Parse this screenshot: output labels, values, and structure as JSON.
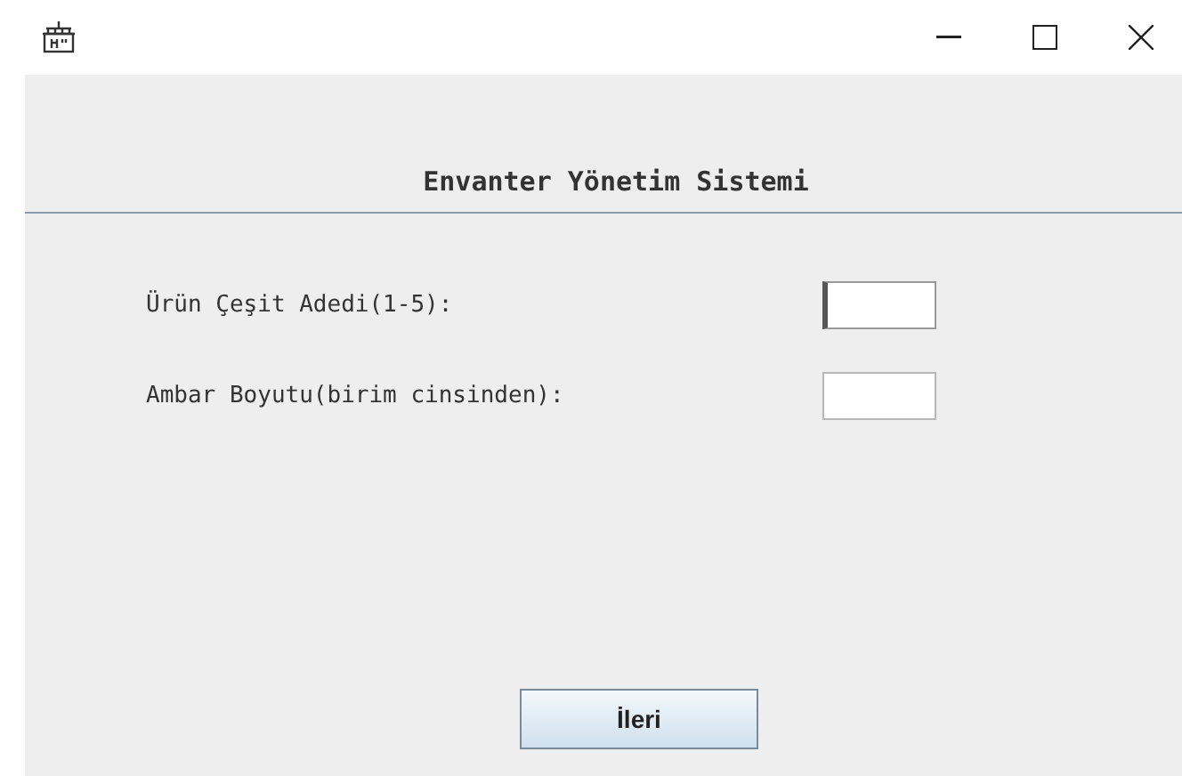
{
  "heading": "Envanter Yönetim Sistemi",
  "fields": [
    {
      "label": "Ürün Çeşit Adedi(1-5):",
      "focused": true
    },
    {
      "label": "Ambar Boyutu(birim cinsinden):",
      "focused": false
    }
  ],
  "button": "İleri"
}
